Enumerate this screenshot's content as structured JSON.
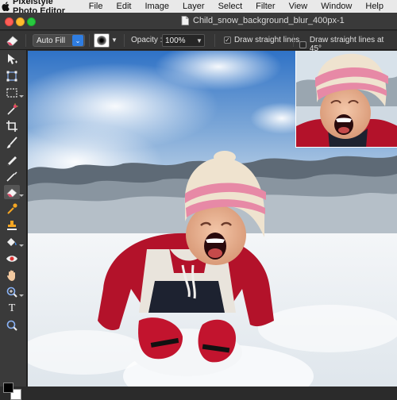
{
  "menubar": {
    "app_name": "Pixelstyle Photo Editor",
    "items": [
      "File",
      "Edit",
      "Image",
      "Layer",
      "Select",
      "Filter",
      "View",
      "Window",
      "Help"
    ]
  },
  "window": {
    "document_title": "Child_snow_background_blur_400px-1"
  },
  "options": {
    "fill_mode": "Auto Fill",
    "opacity_label": "Opacity :",
    "opacity_value": "100%",
    "straight_lines_label": "Draw straight lines",
    "straight_lines_checked": true,
    "straight_lines_45_label": "Draw straight lines at 45°",
    "straight_lines_45_checked": false
  },
  "tools": [
    {
      "name": "move-tool",
      "icon": "move-icon"
    },
    {
      "name": "transform-tool",
      "icon": "transform-icon"
    },
    {
      "name": "marquee-tool",
      "icon": "marquee-icon",
      "has_submenu": true
    },
    {
      "name": "magic-wand-tool",
      "icon": "magic-wand-icon"
    },
    {
      "name": "crop-tool",
      "icon": "crop-icon"
    },
    {
      "name": "brush-tool",
      "icon": "brush-icon"
    },
    {
      "name": "pencil-tool",
      "icon": "pencil-icon"
    },
    {
      "name": "pen-tool",
      "icon": "pen-icon"
    },
    {
      "name": "eraser-tool",
      "icon": "eraser-icon",
      "active": true,
      "has_submenu": true
    },
    {
      "name": "eyedropper-tool",
      "icon": "eyedropper-icon"
    },
    {
      "name": "clone-stamp-tool",
      "icon": "stamp-icon"
    },
    {
      "name": "paint-bucket-tool",
      "icon": "paint-bucket-icon",
      "has_submenu": true
    },
    {
      "name": "red-eye-tool",
      "icon": "eye-icon"
    },
    {
      "name": "hand-tool",
      "icon": "hand-icon"
    },
    {
      "name": "zoom-tool",
      "icon": "zoom-icon",
      "has_submenu": true
    },
    {
      "name": "text-tool",
      "icon": "text-icon"
    },
    {
      "name": "search-tool",
      "icon": "magnifier-icon"
    }
  ],
  "colors": {
    "foreground": "#000000",
    "background": "#ffffff",
    "accent": "#2f7de1"
  },
  "text_tool_glyph": "T"
}
